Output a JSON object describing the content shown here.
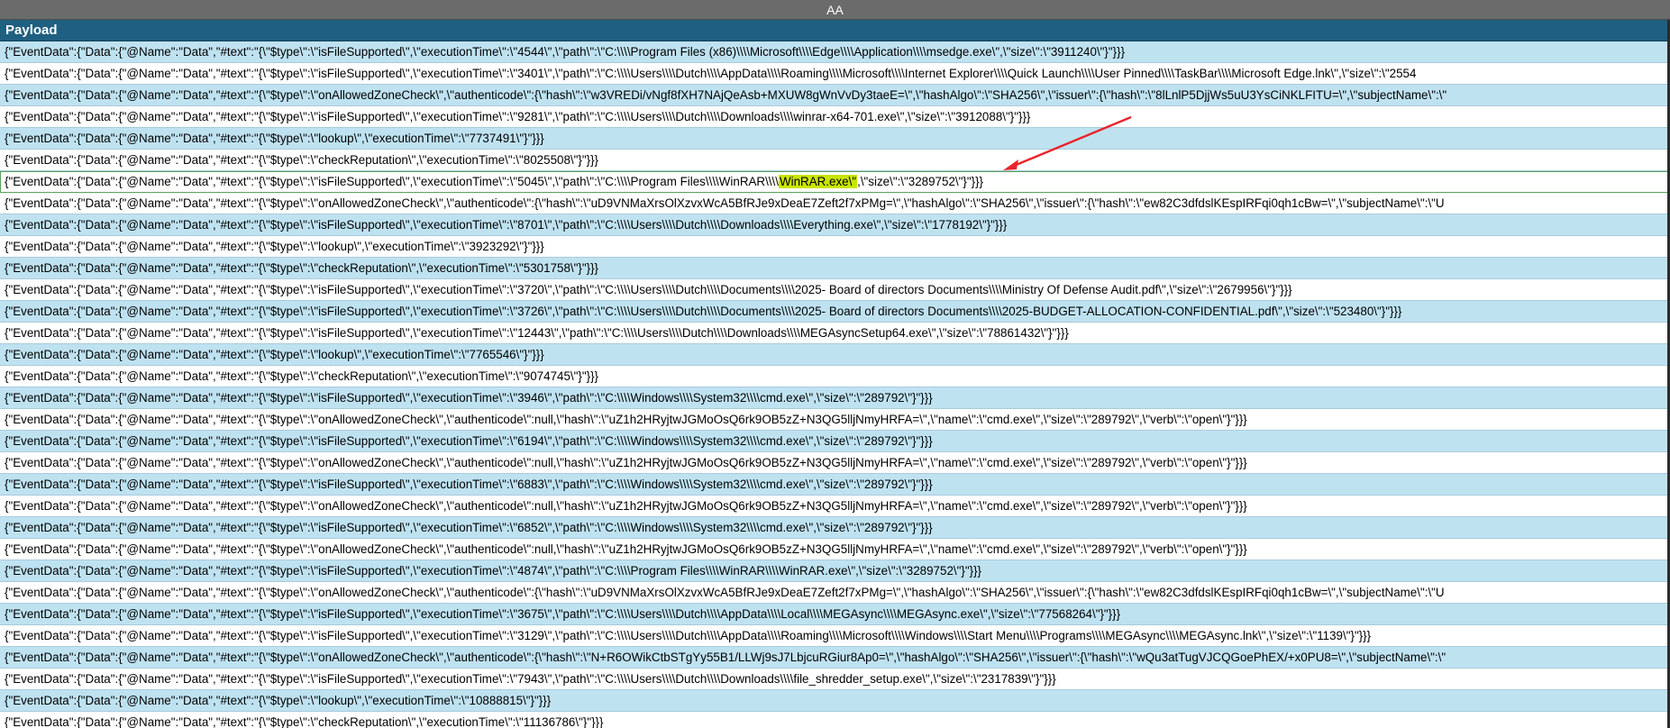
{
  "column_header": "AA",
  "table": {
    "header": "Payload",
    "rows": [
      {
        "text": "{\"EventData\":{\"Data\":{\"@Name\":\"Data\",\"#text\":\"{\\\"$type\\\":\\\"isFileSupported\\\",\\\"executionTime\\\":\\\"4544\\\",\\\"path\\\":\\\"C:\\\\\\\\Program Files (x86)\\\\\\\\Microsoft\\\\\\\\Edge\\\\\\\\Application\\\\\\\\msedge.exe\\\",\\\"size\\\":\\\"3911240\\\"}\"}}}",
        "band": true
      },
      {
        "text": "{\"EventData\":{\"Data\":{\"@Name\":\"Data\",\"#text\":\"{\\\"$type\\\":\\\"isFileSupported\\\",\\\"executionTime\\\":\\\"3401\\\",\\\"path\\\":\\\"C:\\\\\\\\Users\\\\\\\\Dutch\\\\\\\\AppData\\\\\\\\Roaming\\\\\\\\Microsoft\\\\\\\\Internet Explorer\\\\\\\\Quick Launch\\\\\\\\User Pinned\\\\\\\\TaskBar\\\\\\\\Microsoft Edge.lnk\\\",\\\"size\\\":\\\"2554",
        "band": false
      },
      {
        "text": "{\"EventData\":{\"Data\":{\"@Name\":\"Data\",\"#text\":\"{\\\"$type\\\":\\\"onAllowedZoneCheck\\\",\\\"authenticode\\\":{\\\"hash\\\":\\\"w3VREDi/vNgf8fXH7NAjQeAsb+MXUW8gWnVvDy3taeE=\\\",\\\"hashAlgo\\\":\\\"SHA256\\\",\\\"issuer\\\":{\\\"hash\\\":\\\"8lLnlP5DjjWs5uU3YsCiNKLFITU=\\\",\\\"subjectName\\\":\\\"",
        "band": true
      },
      {
        "text": "{\"EventData\":{\"Data\":{\"@Name\":\"Data\",\"#text\":\"{\\\"$type\\\":\\\"isFileSupported\\\",\\\"executionTime\\\":\\\"9281\\\",\\\"path\\\":\\\"C:\\\\\\\\Users\\\\\\\\Dutch\\\\\\\\Downloads\\\\\\\\winrar-x64-701.exe\\\",\\\"size\\\":\\\"3912088\\\"}\"}}}",
        "band": false
      },
      {
        "text": "{\"EventData\":{\"Data\":{\"@Name\":\"Data\",\"#text\":\"{\\\"$type\\\":\\\"lookup\\\",\\\"executionTime\\\":\\\"7737491\\\"}\"}}}",
        "band": true
      },
      {
        "text": "{\"EventData\":{\"Data\":{\"@Name\":\"Data\",\"#text\":\"{\\\"$type\\\":\\\"checkReputation\\\",\\\"executionTime\\\":\\\"8025508\\\"}\"}}}",
        "band": false
      },
      {
        "text_before": "{\"EventData\":{\"Data\":{\"@Name\":\"Data\",\"#text\":\"{\\\"$type\\\":\\\"isFileSupported\\\",\\\"executionTime\\\":\\\"5045\\\",\\\"path\\\":\\\"C:\\\\\\\\Program Files\\\\\\\\WinRAR\\\\\\\\",
        "highlight": "WinRAR.exe\\\"",
        "text_after": ",\\\"size\\\":\\\"3289752\\\"}\"}}}",
        "band": false,
        "selected": true
      },
      {
        "text": "{\"EventData\":{\"Data\":{\"@Name\":\"Data\",\"#text\":\"{\\\"$type\\\":\\\"onAllowedZoneCheck\\\",\\\"authenticode\\\":{\\\"hash\\\":\\\"uD9VNMaXrsOlXzvxWcA5BfRJe9xDeaE7Zeft2f7xPMg=\\\",\\\"hashAlgo\\\":\\\"SHA256\\\",\\\"issuer\\\":{\\\"hash\\\":\\\"ew82C3dfdslKEspIRFqi0qh1cBw=\\\",\\\"subjectName\\\":\\\"U",
        "band": false
      },
      {
        "text": "{\"EventData\":{\"Data\":{\"@Name\":\"Data\",\"#text\":\"{\\\"$type\\\":\\\"isFileSupported\\\",\\\"executionTime\\\":\\\"8701\\\",\\\"path\\\":\\\"C:\\\\\\\\Users\\\\\\\\Dutch\\\\\\\\Downloads\\\\\\\\Everything.exe\\\",\\\"size\\\":\\\"1778192\\\"}\"}}}",
        "band": true
      },
      {
        "text": "{\"EventData\":{\"Data\":{\"@Name\":\"Data\",\"#text\":\"{\\\"$type\\\":\\\"lookup\\\",\\\"executionTime\\\":\\\"3923292\\\"}\"}}}",
        "band": false
      },
      {
        "text": "{\"EventData\":{\"Data\":{\"@Name\":\"Data\",\"#text\":\"{\\\"$type\\\":\\\"checkReputation\\\",\\\"executionTime\\\":\\\"5301758\\\"}\"}}}",
        "band": true
      },
      {
        "text": "{\"EventData\":{\"Data\":{\"@Name\":\"Data\",\"#text\":\"{\\\"$type\\\":\\\"isFileSupported\\\",\\\"executionTime\\\":\\\"3720\\\",\\\"path\\\":\\\"C:\\\\\\\\Users\\\\\\\\Dutch\\\\\\\\Documents\\\\\\\\2025- Board of directors Documents\\\\\\\\Ministry Of Defense Audit.pdf\\\",\\\"size\\\":\\\"2679956\\\"}\"}}}",
        "band": false
      },
      {
        "text": "{\"EventData\":{\"Data\":{\"@Name\":\"Data\",\"#text\":\"{\\\"$type\\\":\\\"isFileSupported\\\",\\\"executionTime\\\":\\\"3726\\\",\\\"path\\\":\\\"C:\\\\\\\\Users\\\\\\\\Dutch\\\\\\\\Documents\\\\\\\\2025- Board of directors Documents\\\\\\\\2025-BUDGET-ALLOCATION-CONFIDENTIAL.pdf\\\",\\\"size\\\":\\\"523480\\\"}\"}}}",
        "band": true
      },
      {
        "text": "{\"EventData\":{\"Data\":{\"@Name\":\"Data\",\"#text\":\"{\\\"$type\\\":\\\"isFileSupported\\\",\\\"executionTime\\\":\\\"12443\\\",\\\"path\\\":\\\"C:\\\\\\\\Users\\\\\\\\Dutch\\\\\\\\Downloads\\\\\\\\MEGAsyncSetup64.exe\\\",\\\"size\\\":\\\"78861432\\\"}\"}}}",
        "band": false
      },
      {
        "text": "{\"EventData\":{\"Data\":{\"@Name\":\"Data\",\"#text\":\"{\\\"$type\\\":\\\"lookup\\\",\\\"executionTime\\\":\\\"7765546\\\"}\"}}}",
        "band": true
      },
      {
        "text": "{\"EventData\":{\"Data\":{\"@Name\":\"Data\",\"#text\":\"{\\\"$type\\\":\\\"checkReputation\\\",\\\"executionTime\\\":\\\"9074745\\\"}\"}}}",
        "band": false
      },
      {
        "text": "{\"EventData\":{\"Data\":{\"@Name\":\"Data\",\"#text\":\"{\\\"$type\\\":\\\"isFileSupported\\\",\\\"executionTime\\\":\\\"3946\\\",\\\"path\\\":\\\"C:\\\\\\\\Windows\\\\\\\\System32\\\\\\\\cmd.exe\\\",\\\"size\\\":\\\"289792\\\"}\"}}}",
        "band": true
      },
      {
        "text": "{\"EventData\":{\"Data\":{\"@Name\":\"Data\",\"#text\":\"{\\\"$type\\\":\\\"onAllowedZoneCheck\\\",\\\"authenticode\\\":null,\\\"hash\\\":\\\"uZ1h2HRyjtwJGMoOsQ6rk9OB5zZ+N3QG5lljNmyHRFA=\\\",\\\"name\\\":\\\"cmd.exe\\\",\\\"size\\\":\\\"289792\\\",\\\"verb\\\":\\\"open\\\"}\"}}}",
        "band": false
      },
      {
        "text": "{\"EventData\":{\"Data\":{\"@Name\":\"Data\",\"#text\":\"{\\\"$type\\\":\\\"isFileSupported\\\",\\\"executionTime\\\":\\\"6194\\\",\\\"path\\\":\\\"C:\\\\\\\\Windows\\\\\\\\System32\\\\\\\\cmd.exe\\\",\\\"size\\\":\\\"289792\\\"}\"}}}",
        "band": true
      },
      {
        "text": "{\"EventData\":{\"Data\":{\"@Name\":\"Data\",\"#text\":\"{\\\"$type\\\":\\\"onAllowedZoneCheck\\\",\\\"authenticode\\\":null,\\\"hash\\\":\\\"uZ1h2HRyjtwJGMoOsQ6rk9OB5zZ+N3QG5lljNmyHRFA=\\\",\\\"name\\\":\\\"cmd.exe\\\",\\\"size\\\":\\\"289792\\\",\\\"verb\\\":\\\"open\\\"}\"}}}",
        "band": false
      },
      {
        "text": "{\"EventData\":{\"Data\":{\"@Name\":\"Data\",\"#text\":\"{\\\"$type\\\":\\\"isFileSupported\\\",\\\"executionTime\\\":\\\"6883\\\",\\\"path\\\":\\\"C:\\\\\\\\Windows\\\\\\\\System32\\\\\\\\cmd.exe\\\",\\\"size\\\":\\\"289792\\\"}\"}}}",
        "band": true
      },
      {
        "text": "{\"EventData\":{\"Data\":{\"@Name\":\"Data\",\"#text\":\"{\\\"$type\\\":\\\"onAllowedZoneCheck\\\",\\\"authenticode\\\":null,\\\"hash\\\":\\\"uZ1h2HRyjtwJGMoOsQ6rk9OB5zZ+N3QG5lljNmyHRFA=\\\",\\\"name\\\":\\\"cmd.exe\\\",\\\"size\\\":\\\"289792\\\",\\\"verb\\\":\\\"open\\\"}\"}}}",
        "band": false
      },
      {
        "text": "{\"EventData\":{\"Data\":{\"@Name\":\"Data\",\"#text\":\"{\\\"$type\\\":\\\"isFileSupported\\\",\\\"executionTime\\\":\\\"6852\\\",\\\"path\\\":\\\"C:\\\\\\\\Windows\\\\\\\\System32\\\\\\\\cmd.exe\\\",\\\"size\\\":\\\"289792\\\"}\"}}}",
        "band": true
      },
      {
        "text": "{\"EventData\":{\"Data\":{\"@Name\":\"Data\",\"#text\":\"{\\\"$type\\\":\\\"onAllowedZoneCheck\\\",\\\"authenticode\\\":null,\\\"hash\\\":\\\"uZ1h2HRyjtwJGMoOsQ6rk9OB5zZ+N3QG5lljNmyHRFA=\\\",\\\"name\\\":\\\"cmd.exe\\\",\\\"size\\\":\\\"289792\\\",\\\"verb\\\":\\\"open\\\"}\"}}}",
        "band": false
      },
      {
        "text": "{\"EventData\":{\"Data\":{\"@Name\":\"Data\",\"#text\":\"{\\\"$type\\\":\\\"isFileSupported\\\",\\\"executionTime\\\":\\\"4874\\\",\\\"path\\\":\\\"C:\\\\\\\\Program Files\\\\\\\\WinRAR\\\\\\\\WinRAR.exe\\\",\\\"size\\\":\\\"3289752\\\"}\"}}}",
        "band": true
      },
      {
        "text": "{\"EventData\":{\"Data\":{\"@Name\":\"Data\",\"#text\":\"{\\\"$type\\\":\\\"onAllowedZoneCheck\\\",\\\"authenticode\\\":{\\\"hash\\\":\\\"uD9VNMaXrsOlXzvxWcA5BfRJe9xDeaE7Zeft2f7xPMg=\\\",\\\"hashAlgo\\\":\\\"SHA256\\\",\\\"issuer\\\":{\\\"hash\\\":\\\"ew82C3dfdslKEspIRFqi0qh1cBw=\\\",\\\"subjectName\\\":\\\"U",
        "band": false
      },
      {
        "text": "{\"EventData\":{\"Data\":{\"@Name\":\"Data\",\"#text\":\"{\\\"$type\\\":\\\"isFileSupported\\\",\\\"executionTime\\\":\\\"3675\\\",\\\"path\\\":\\\"C:\\\\\\\\Users\\\\\\\\Dutch\\\\\\\\AppData\\\\\\\\Local\\\\\\\\MEGAsync\\\\\\\\MEGAsync.exe\\\",\\\"size\\\":\\\"77568264\\\"}\"}}}",
        "band": true
      },
      {
        "text": "{\"EventData\":{\"Data\":{\"@Name\":\"Data\",\"#text\":\"{\\\"$type\\\":\\\"isFileSupported\\\",\\\"executionTime\\\":\\\"3129\\\",\\\"path\\\":\\\"C:\\\\\\\\Users\\\\\\\\Dutch\\\\\\\\AppData\\\\\\\\Roaming\\\\\\\\Microsoft\\\\\\\\Windows\\\\\\\\Start Menu\\\\\\\\Programs\\\\\\\\MEGAsync\\\\\\\\MEGAsync.lnk\\\",\\\"size\\\":\\\"1139\\\"}\"}}}",
        "band": false
      },
      {
        "text": "{\"EventData\":{\"Data\":{\"@Name\":\"Data\",\"#text\":\"{\\\"$type\\\":\\\"onAllowedZoneCheck\\\",\\\"authenticode\\\":{\\\"hash\\\":\\\"N+R6OWikCtbSTgYy55B1/LLWj9sJ7LbjcuRGiur8Ap0=\\\",\\\"hashAlgo\\\":\\\"SHA256\\\",\\\"issuer\\\":{\\\"hash\\\":\\\"wQu3atTugVJCQGoePhEX/+x0PU8=\\\",\\\"subjectName\\\":\\\"",
        "band": true
      },
      {
        "text": "{\"EventData\":{\"Data\":{\"@Name\":\"Data\",\"#text\":\"{\\\"$type\\\":\\\"isFileSupported\\\",\\\"executionTime\\\":\\\"7943\\\",\\\"path\\\":\\\"C:\\\\\\\\Users\\\\\\\\Dutch\\\\\\\\Downloads\\\\\\\\file_shredder_setup.exe\\\",\\\"size\\\":\\\"2317839\\\"}\"}}}",
        "band": false
      },
      {
        "text": "{\"EventData\":{\"Data\":{\"@Name\":\"Data\",\"#text\":\"{\\\"$type\\\":\\\"lookup\\\",\\\"executionTime\\\":\\\"10888815\\\"}\"}}}",
        "band": true
      },
      {
        "text": "{\"EventData\":{\"Data\":{\"@Name\":\"Data\",\"#text\":\"{\\\"$type\\\":\\\"checkReputation\\\",\\\"executionTime\\\":\\\"11136786\\\"}\"}}}",
        "band": false
      }
    ]
  },
  "colors": {
    "header_bg": "#1f5f80",
    "band_bg": "#bfe2f1",
    "highlight": "#c7e600",
    "arrow": "#e8242b"
  },
  "annotation": {
    "icon": "red-arrow-icon"
  }
}
